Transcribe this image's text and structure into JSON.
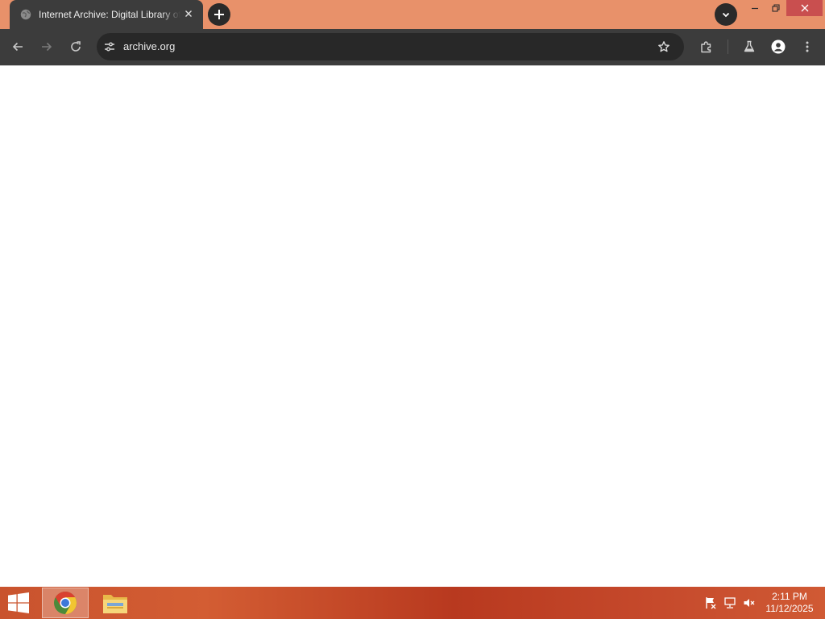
{
  "browser": {
    "tab": {
      "title": "Internet Archive: Digital Library of Free & Borrowable Texts, Movies, Music & Wayback Machine",
      "favicon": "globe-icon",
      "close_icon": "close-icon"
    },
    "new_tab_icon": "plus-icon",
    "tab_search_icon": "chevron-down-icon",
    "window_controls": [
      "minimize-icon",
      "restore-icon",
      "close-icon"
    ],
    "toolbar": {
      "back_icon": "arrow-left-icon",
      "forward_icon": "arrow-right-icon",
      "reload_icon": "reload-icon",
      "site_info_icon": "tune-icon",
      "url": "archive.org",
      "bookmark_icon": "star-icon",
      "extensions_icon": "puzzle-icon",
      "labs_icon": "flask-icon",
      "profile_icon": "person-icon",
      "menu_icon": "kebab-icon"
    }
  },
  "taskbar": {
    "start_icon": "windows-logo-icon",
    "pinned": [
      {
        "name": "Google Chrome",
        "icon": "chrome-icon",
        "active": true
      },
      {
        "name": "File Explorer",
        "icon": "folder-icon",
        "active": false
      }
    ],
    "tray": [
      "action-center-flag-icon",
      "network-icon",
      "volume-muted-icon"
    ],
    "clock": {
      "time": "2:11 PM",
      "date": "11/12/2025"
    }
  },
  "colors": {
    "tabstrip": "#e8916a",
    "toolbar": "#3c3c3c",
    "omnibox": "#282828",
    "taskbar": "#c64a2c"
  }
}
